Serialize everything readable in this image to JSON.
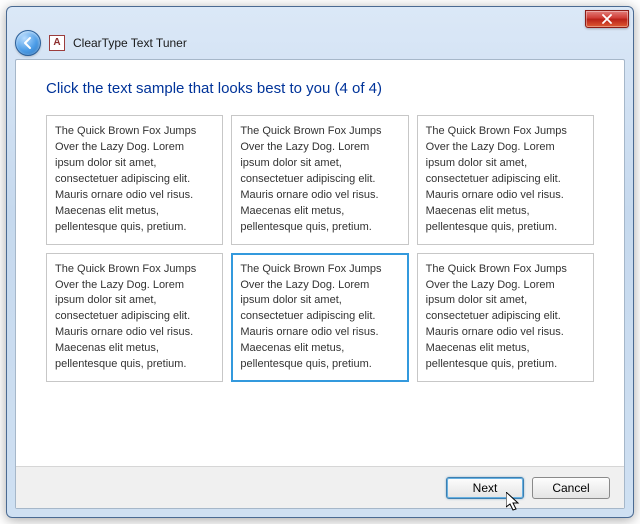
{
  "window": {
    "title": "ClearType Text Tuner",
    "app_icon_letter": "A"
  },
  "instruction": "Click the text sample that looks best to you (4 of 4)",
  "sample_text": "The Quick Brown Fox Jumps Over the Lazy Dog. Lorem ipsum dolor sit amet, consectetuer adipiscing elit. Mauris ornare odio vel risus. Maecenas elit metus, pellentesque quis, pretium.",
  "samples": [
    {
      "selected": false
    },
    {
      "selected": false
    },
    {
      "selected": false
    },
    {
      "selected": false
    },
    {
      "selected": true
    },
    {
      "selected": false
    }
  ],
  "buttons": {
    "next": "Next",
    "cancel": "Cancel"
  }
}
